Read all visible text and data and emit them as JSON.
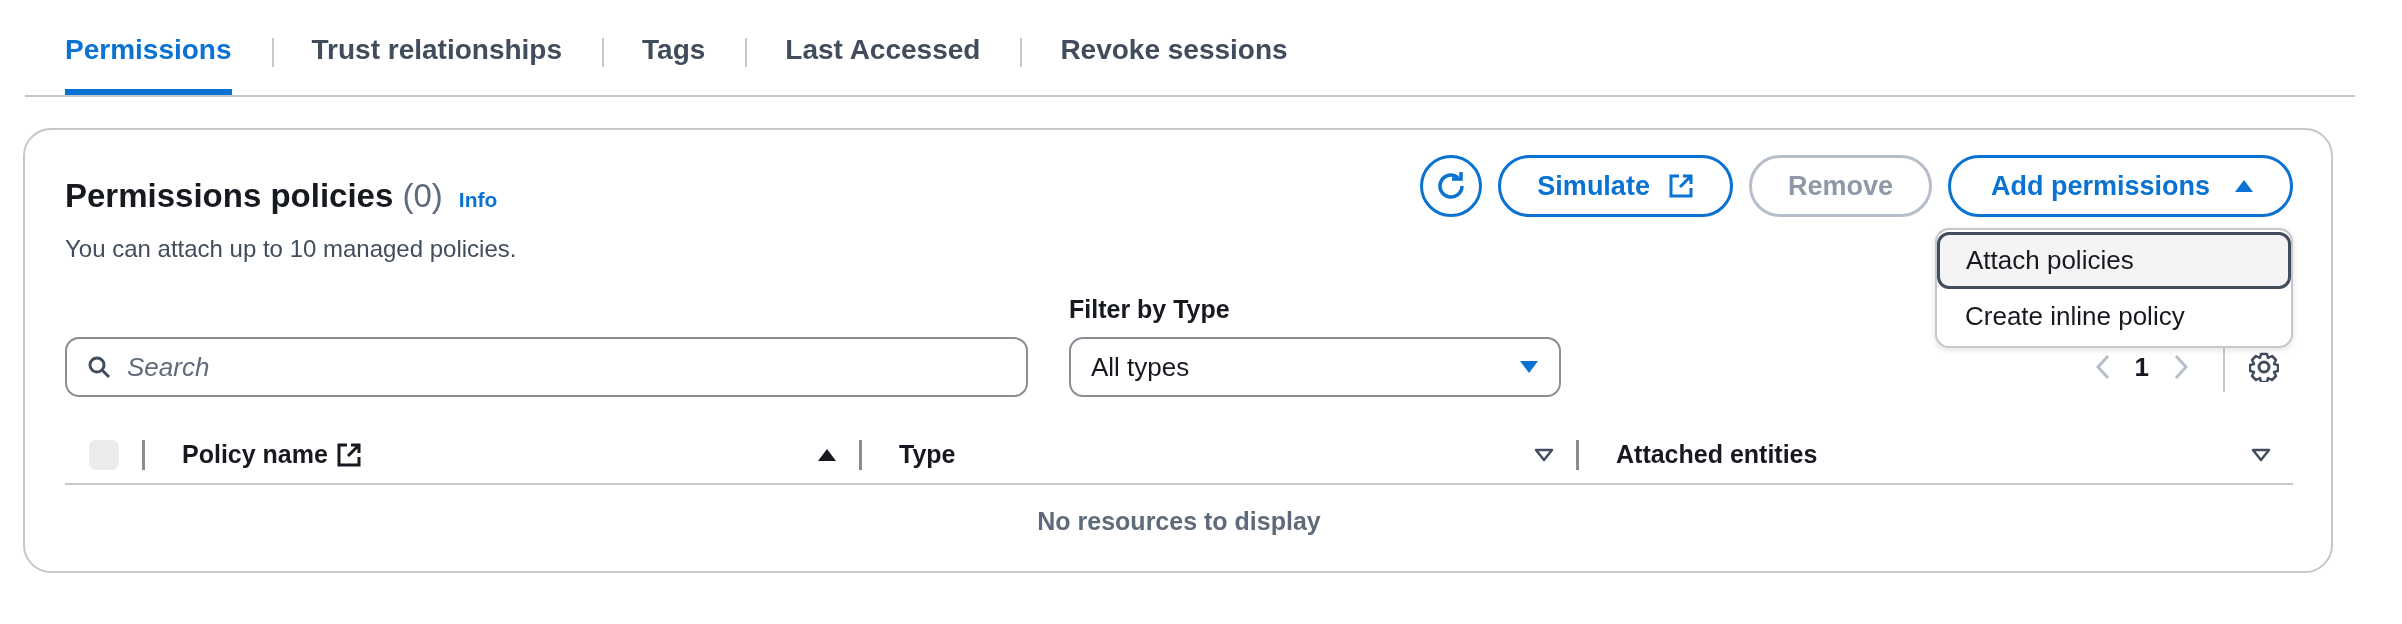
{
  "tabs": [
    {
      "label": "Permissions",
      "selected": true
    },
    {
      "label": "Trust relationships",
      "selected": false
    },
    {
      "label": "Tags",
      "selected": false
    },
    {
      "label": "Last Accessed",
      "selected": false
    },
    {
      "label": "Revoke sessions",
      "selected": false
    }
  ],
  "panel": {
    "title": "Permissions policies",
    "count": "(0)",
    "info_link": "Info",
    "description": "You can attach up to 10 managed policies.",
    "actions": [
      {
        "kind": "refresh"
      },
      {
        "kind": "external",
        "label": "Simulate",
        "disabled": false
      },
      {
        "kind": "plain",
        "label": "Remove",
        "disabled": true
      },
      {
        "kind": "dropdown",
        "label": "Add permissions",
        "expanded": true,
        "menu": [
          {
            "label": "Attach policies",
            "selected": true
          },
          {
            "label": "Create inline policy",
            "selected": false
          }
        ]
      }
    ],
    "search": {
      "placeholder": "Search"
    },
    "filter": {
      "label": "Filter by Type",
      "value": "All types"
    },
    "pagination": {
      "page": "1"
    },
    "table": {
      "select_all": {
        "checked": false,
        "disabled": true
      },
      "columns": [
        {
          "label": "Policy name",
          "external": true,
          "sorted": true
        },
        {
          "label": "Type",
          "external": false,
          "sorted": false
        },
        {
          "label": "Attached entities",
          "external": false,
          "sorted": false
        }
      ],
      "empty_message": "No resources to display"
    }
  }
}
